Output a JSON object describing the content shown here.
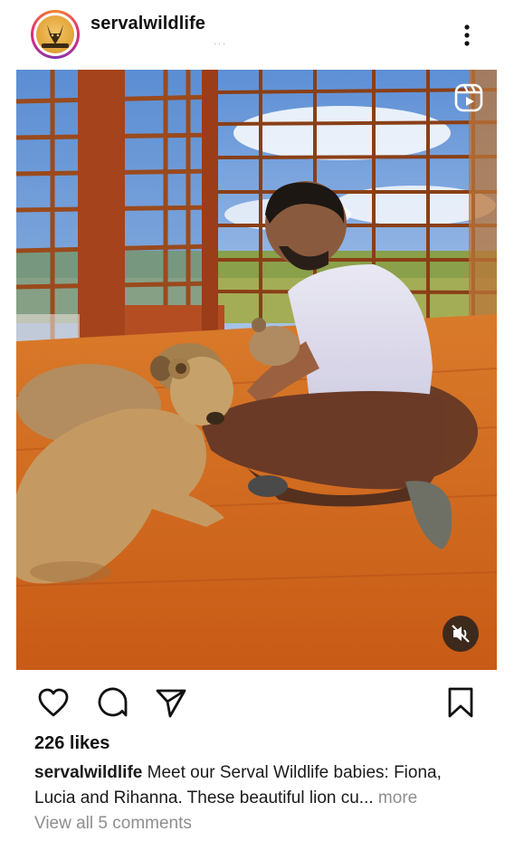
{
  "post": {
    "username": "servalwildlife",
    "header_subtext": "...",
    "avatar_label": "SERVAL",
    "likes": "226 likes",
    "caption": {
      "username": "servalwildlife",
      "text": "Meet our Serval Wildlife babies: Fiona, Lucia and Rihanna. These beautiful lion cu",
      "ellipsis": "...",
      "more": "more"
    },
    "comments_link": "View all 5 comments"
  },
  "icons": {
    "more": "more-vertical-icon",
    "reels": "reels-icon",
    "mute": "speaker-muted-icon",
    "like": "heart-icon",
    "comment": "comment-bubble-icon",
    "share": "paper-plane-icon",
    "save": "bookmark-icon"
  },
  "colors": {
    "text": "#111111",
    "secondary_text": "#8e8e8e",
    "story_ring": "#dd2a7b",
    "floor": "#d2691e"
  }
}
